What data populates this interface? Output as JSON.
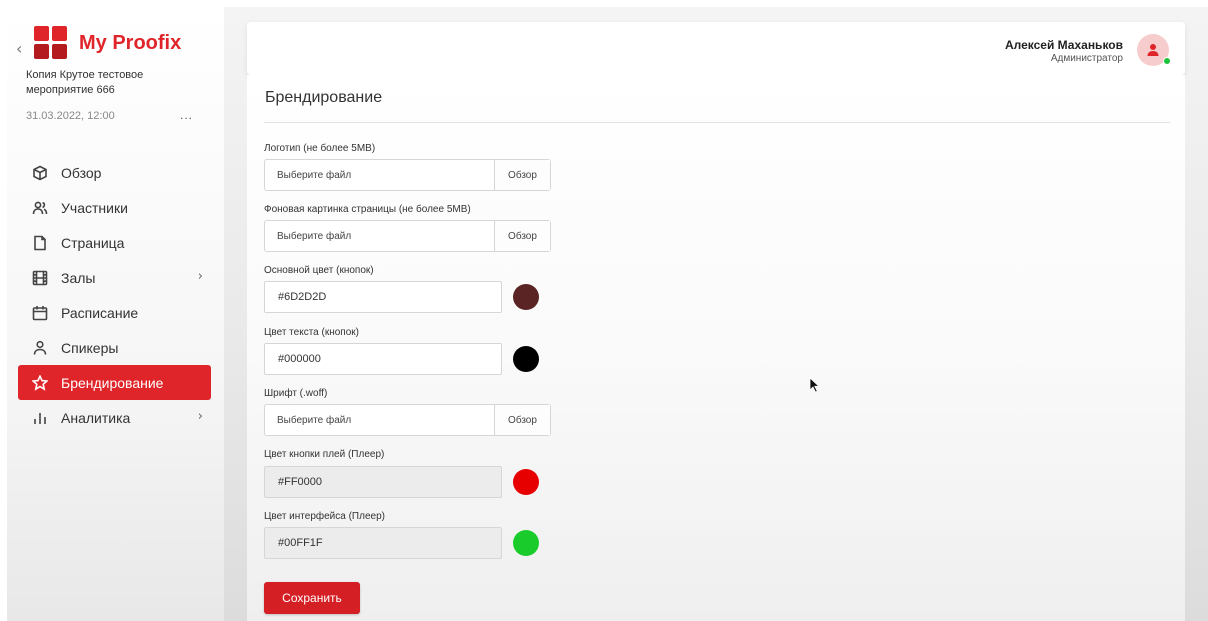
{
  "sidebar": {
    "back_icon": "chevron-left-icon",
    "brand": "My Proofix",
    "brand_color": "#e0252a",
    "event_name": "Копия Крутое тестовое мероприятие 666",
    "event_date": "31.03.2022, 12:00",
    "more": "...",
    "items": [
      {
        "label": "Обзор",
        "icon": "cube-icon"
      },
      {
        "label": "Участники",
        "icon": "users-icon"
      },
      {
        "label": "Страница",
        "icon": "page-icon"
      },
      {
        "label": "Залы",
        "icon": "film-icon",
        "has_submenu": true
      },
      {
        "label": "Расписание",
        "icon": "calendar-icon"
      },
      {
        "label": "Спикеры",
        "icon": "speaker-icon"
      },
      {
        "label": "Брендирование",
        "icon": "star-icon",
        "active": true
      },
      {
        "label": "Аналитика",
        "icon": "bar-chart-icon",
        "has_submenu": true
      }
    ],
    "chevron": "›"
  },
  "header": {
    "user_name": "Алексей Маханьков",
    "user_role": "Администратор",
    "avatar_icon": "user-avatar-icon",
    "status_color": "#1bc43a"
  },
  "main": {
    "title": "Брендирование",
    "logo": {
      "label": "Логотип (не более 5MB)",
      "placeholder": "Выберите файл",
      "browse": "Обзор"
    },
    "background": {
      "label": "Фоновая картинка страницы (не более 5MB)",
      "placeholder": "Выберите файл",
      "browse": "Обзор"
    },
    "primary_color": {
      "label": "Основной цвет (кнопок)",
      "value": "#6D2D2D",
      "swatch": "#5a2424"
    },
    "text_color": {
      "label": "Цвет текста (кнопок)",
      "value": "#000000",
      "swatch": "#000000"
    },
    "font": {
      "label": "Шрифт (.woff)",
      "placeholder": "Выберите файл",
      "browse": "Обзор"
    },
    "play_color": {
      "label": "Цвет кнопки плей (Плеер)",
      "value": "#FF0000",
      "swatch": "#e60000"
    },
    "ui_color": {
      "label": "Цвет интерфейса (Плеер)",
      "value": "#00FF1F",
      "swatch": "#19cc2c"
    },
    "save": "Сохранить",
    "accent_color": "#d41f25"
  }
}
